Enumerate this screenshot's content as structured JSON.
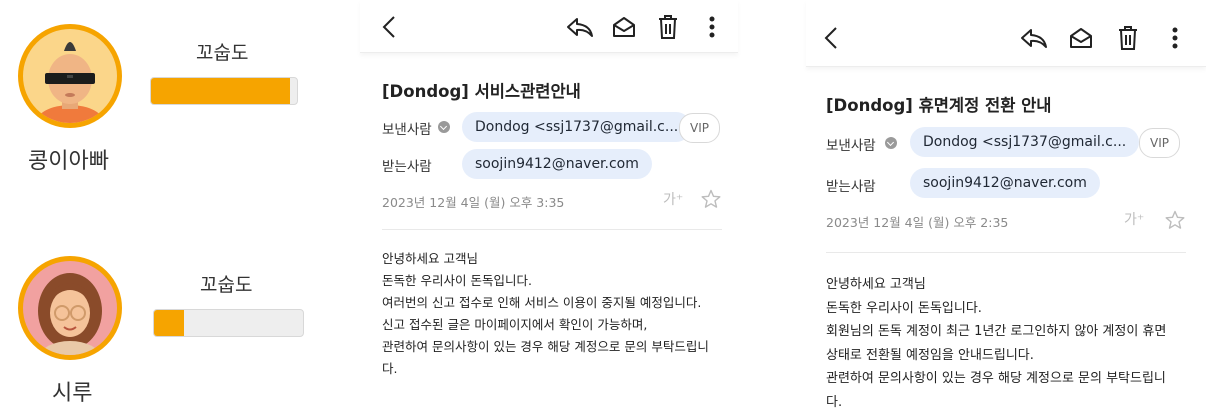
{
  "profiles": [
    {
      "name": "콩이아빠",
      "stat_label": "꼬숩도",
      "stat_level": 0.95
    },
    {
      "name": "시루",
      "stat_label": "꼬숩도",
      "stat_level": 0.2
    }
  ],
  "emails": [
    {
      "subject": "[Dondog] 서비스관련안내",
      "sender_label": "보낸사람",
      "sender": "Dondog <ssj1737@gmail.c...",
      "vip_label": "VIP",
      "recipient_label": "받는사람",
      "recipient": "soojin9412@naver.com",
      "date": "2023년 12월 4일 (월) 오후 3:35",
      "font_size_label": "가⁺",
      "body": [
        "안녕하세요 고객님",
        "돈독한 우리사이 돈독입니다.",
        "여러번의 신고 접수로 인해 서비스 이용이 중지될 예정입니다.",
        "신고 접수된 글은 마이페이지에서 확인이 가능하며,",
        "관련하여 문의사항이 있는 경우 해당 계정으로 문의 부탁드립니",
        "다."
      ]
    },
    {
      "subject": "[Dondog] 휴면계정 전환 안내",
      "sender_label": "보낸사람",
      "sender": "Dondog <ssj1737@gmail.c...",
      "vip_label": "VIP",
      "recipient_label": "받는사람",
      "recipient": "soojin9412@naver.com",
      "date": "2023년 12월 4일 (월) 오후 2:35",
      "font_size_label": "가⁺",
      "body": [
        "안녕하세요 고객님",
        "돈독한 우리사이 돈독입니다.",
        "회원님의 돈독 계정이 최근 1년간 로그인하지 않아 계정이 휴면",
        "상태로 전환될 예정임을 안내드립니다.",
        "관련하여 문의사항이 있는 경우 해당 계정으로 문의 부탁드립니",
        "다."
      ]
    }
  ],
  "colors": {
    "accent": "#f6a400",
    "chip": "#e6eefb"
  },
  "icons": [
    "back-icon",
    "reply-icon",
    "mail-open-icon",
    "trash-icon",
    "more-icon",
    "star-icon"
  ]
}
